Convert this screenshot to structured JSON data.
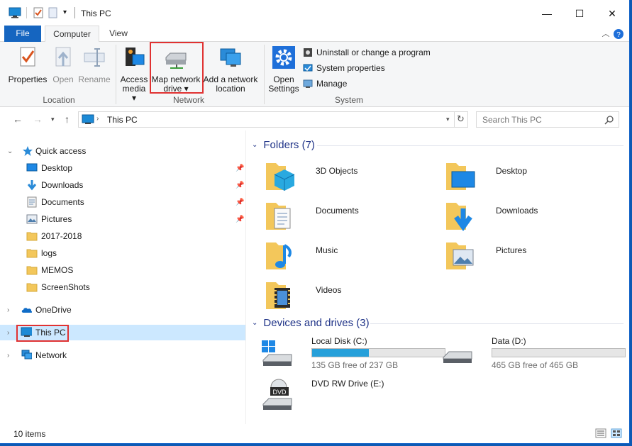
{
  "window": {
    "title": "This PC",
    "minimize": "—",
    "maximize": "☐",
    "close": "✕"
  },
  "tabs": {
    "file": "File",
    "computer": "Computer",
    "view": "View"
  },
  "ribbon": {
    "location": {
      "label": "Location",
      "properties": "Properties",
      "open": "Open",
      "rename": "Rename"
    },
    "network": {
      "label": "Network",
      "access_media_1": "Access",
      "access_media_2": "media",
      "map_drive_1": "Map network",
      "map_drive_2": "drive",
      "add_location_1": "Add a network",
      "add_location_2": "location"
    },
    "system": {
      "label": "System",
      "open_settings_1": "Open",
      "open_settings_2": "Settings",
      "uninstall": "Uninstall or change a program",
      "system_properties": "System properties",
      "manage": "Manage"
    }
  },
  "address": {
    "path": "This PC",
    "search_placeholder": "Search This PC"
  },
  "nav": {
    "quick_access": "Quick access",
    "items": [
      {
        "label": "Desktop"
      },
      {
        "label": "Downloads"
      },
      {
        "label": "Documents"
      },
      {
        "label": "Pictures"
      },
      {
        "label": "2017-2018"
      },
      {
        "label": "logs"
      },
      {
        "label": "MEMOS"
      },
      {
        "label": "ScreenShots"
      }
    ],
    "onedrive": "OneDrive",
    "this_pc": "This PC",
    "network": "Network"
  },
  "folders": {
    "header": "Folders (7)",
    "items": [
      {
        "label": "3D Objects"
      },
      {
        "label": "Desktop"
      },
      {
        "label": "Documents"
      },
      {
        "label": "Downloads"
      },
      {
        "label": "Music"
      },
      {
        "label": "Pictures"
      },
      {
        "label": "Videos"
      }
    ]
  },
  "drives": {
    "header": "Devices and drives (3)",
    "items": [
      {
        "label": "Local Disk (C:)",
        "free": "135 GB free of 237 GB",
        "used_fraction": 0.43
      },
      {
        "label": "Data (D:)",
        "free": "465 GB free of 465 GB",
        "used_fraction": 0.0
      },
      {
        "label": "DVD RW Drive (E:)",
        "badge": "DVD"
      }
    ]
  },
  "status": {
    "count": "10 items"
  },
  "colors": {
    "accent": "#1565c0",
    "selection": "#cce8ff",
    "highlight": "#e03232",
    "drive_fill": "#26a0da",
    "folder": "#f3c75b"
  }
}
